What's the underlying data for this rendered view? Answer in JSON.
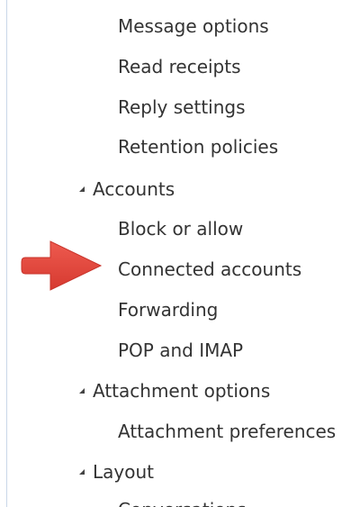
{
  "nav": {
    "items": [
      {
        "label": "Message options",
        "level": "sub"
      },
      {
        "label": "Read receipts",
        "level": "sub"
      },
      {
        "label": "Reply settings",
        "level": "sub"
      },
      {
        "label": "Retention policies",
        "level": "sub"
      },
      {
        "label": "Accounts",
        "level": "category",
        "expanded": true
      },
      {
        "label": "Block or allow",
        "level": "sub"
      },
      {
        "label": "Connected accounts",
        "level": "sub",
        "highlighted": true
      },
      {
        "label": "Forwarding",
        "level": "sub"
      },
      {
        "label": "POP and IMAP",
        "level": "sub"
      },
      {
        "label": "Attachment options",
        "level": "category",
        "expanded": true
      },
      {
        "label": "Attachment preferences",
        "level": "sub"
      },
      {
        "label": "Layout",
        "level": "category",
        "expanded": true
      },
      {
        "label": "Conversations",
        "level": "sub",
        "partially_visible": true
      }
    ]
  },
  "annotation": {
    "arrow_icon": "red-arrow-icon",
    "color": "#e0453a",
    "points_to": "Connected accounts"
  },
  "colors": {
    "text": "#333333",
    "border": "#c9d7e8",
    "expand_triangle": "#444444"
  }
}
